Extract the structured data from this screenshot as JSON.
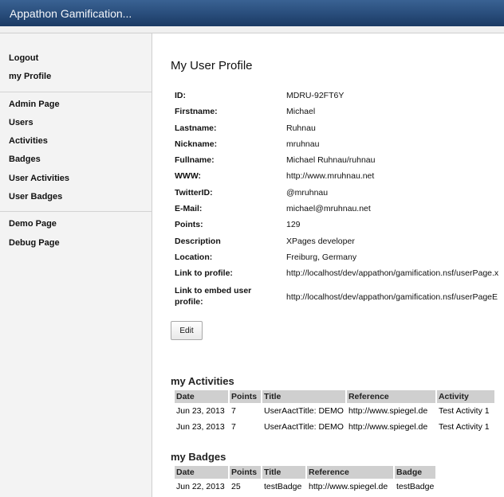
{
  "header": {
    "title": "Appathon Gamification..."
  },
  "sidebar": {
    "group1": [
      {
        "label": "Logout"
      },
      {
        "label": "my Profile"
      }
    ],
    "group2": [
      {
        "label": "Admin Page"
      },
      {
        "label": "Users"
      },
      {
        "label": "Activities"
      },
      {
        "label": "Badges"
      },
      {
        "label": "User Activities"
      },
      {
        "label": "User Badges"
      }
    ],
    "group3": [
      {
        "label": "Demo Page"
      },
      {
        "label": "Debug Page"
      }
    ]
  },
  "main": {
    "title": "My User Profile",
    "profile": [
      {
        "label": "ID:",
        "value": "MDRU-92FT6Y"
      },
      {
        "label": "Firstname:",
        "value": "Michael"
      },
      {
        "label": "Lastname:",
        "value": "Ruhnau"
      },
      {
        "label": "Nickname:",
        "value": "mruhnau"
      },
      {
        "label": "Fullname:",
        "value": "Michael Ruhnau/ruhnau"
      },
      {
        "label": "WWW:",
        "value": "http://www.mruhnau.net"
      },
      {
        "label": "TwitterID:",
        "value": "@mruhnau"
      },
      {
        "label": "E-Mail:",
        "value": "michael@mruhnau.net"
      },
      {
        "label": "Points:",
        "value": "129"
      },
      {
        "label": "Description",
        "value": "XPages developer"
      },
      {
        "label": "Location:",
        "value": "Freiburg, Germany"
      },
      {
        "label": "Link to profile:",
        "value": "http://localhost/dev/appathon/gamification.nsf/userPage.x"
      },
      {
        "label": "Link to embed user profile:",
        "value": "http://localhost/dev/appathon/gamification.nsf/userPageE"
      }
    ],
    "edit_label": "Edit",
    "activities": {
      "title": "my Activities",
      "columns": [
        "Date",
        "Points",
        "Title",
        "Reference",
        "Activity"
      ],
      "rows": [
        [
          "Jun 23, 2013",
          "7",
          "UserAactTitle: DEMO",
          "http://www.spiegel.de",
          "Test Activity 1"
        ],
        [
          "Jun 23, 2013",
          "7",
          "UserAactTitle: DEMO",
          "http://www.spiegel.de",
          "Test Activity 1"
        ]
      ]
    },
    "badges": {
      "title": "my Badges",
      "columns": [
        "Date",
        "Points",
        "Title",
        "Reference",
        "Badge"
      ],
      "rows": [
        [
          "Jun 22, 2013",
          "25",
          "testBadge",
          "http://www.spiegel.de",
          "testBadge"
        ]
      ]
    }
  }
}
